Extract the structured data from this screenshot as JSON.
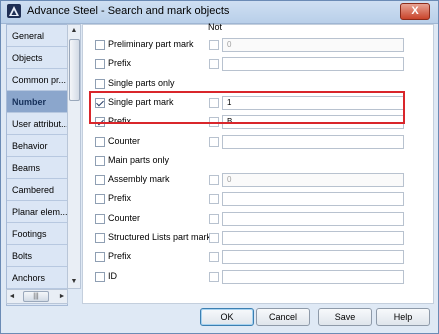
{
  "window": {
    "title": "Advance Steel - Search and mark objects",
    "close_label": "X"
  },
  "sidebar": {
    "items": [
      {
        "label": "General",
        "active": false
      },
      {
        "label": "Objects",
        "active": false
      },
      {
        "label": "Common pr...",
        "active": false
      },
      {
        "label": "Number",
        "active": true
      },
      {
        "label": "User attribut...",
        "active": false
      },
      {
        "label": "Behavior",
        "active": false
      },
      {
        "label": "Beams",
        "active": false
      },
      {
        "label": "Cambered",
        "active": false
      },
      {
        "label": "Planar elem...",
        "active": false
      },
      {
        "label": "Footings",
        "active": false
      },
      {
        "label": "Bolts",
        "active": false
      },
      {
        "label": "Anchors",
        "active": false
      }
    ],
    "scroll_up": "▲",
    "scroll_down": "▼",
    "scroll_left": "◄",
    "scroll_right": "►",
    "grip": "|||"
  },
  "main": {
    "not_header": "Not",
    "rows": [
      {
        "label": "Preliminary part mark",
        "checked": false,
        "has_not": true,
        "has_field": true,
        "value": "0",
        "disabled": true
      },
      {
        "label": "Prefix",
        "checked": false,
        "has_not": true,
        "has_field": true,
        "value": "",
        "disabled": false
      },
      {
        "label": "Single parts only",
        "checked": false,
        "has_not": false,
        "has_field": false,
        "value": "",
        "disabled": false
      },
      {
        "label": "Single part mark",
        "checked": true,
        "has_not": true,
        "has_field": true,
        "value": "1",
        "disabled": false
      },
      {
        "label": "Prefix",
        "checked": true,
        "has_not": true,
        "has_field": true,
        "value": "B",
        "disabled": false
      },
      {
        "label": "Counter",
        "checked": false,
        "has_not": true,
        "has_field": true,
        "value": "",
        "disabled": false
      },
      {
        "label": "Main parts only",
        "checked": false,
        "has_not": false,
        "has_field": false,
        "value": "",
        "disabled": false
      },
      {
        "label": "Assembly mark",
        "checked": false,
        "has_not": true,
        "has_field": true,
        "value": "0",
        "disabled": true
      },
      {
        "label": "Prefix",
        "checked": false,
        "has_not": true,
        "has_field": true,
        "value": "",
        "disabled": false
      },
      {
        "label": "Counter",
        "checked": false,
        "has_not": true,
        "has_field": true,
        "value": "",
        "disabled": false
      },
      {
        "label": "Structured Lists part mark",
        "checked": false,
        "has_not": true,
        "has_field": true,
        "value": "",
        "disabled": false
      },
      {
        "label": "Prefix",
        "checked": false,
        "has_not": true,
        "has_field": true,
        "value": "",
        "disabled": false
      },
      {
        "label": "ID",
        "checked": false,
        "has_not": true,
        "has_field": true,
        "value": "",
        "disabled": false
      }
    ]
  },
  "footer": {
    "ok": "OK",
    "cancel": "Cancel",
    "save": "Save",
    "help": "Help"
  },
  "colors": {
    "highlight": "#d9262b",
    "active_tab": "#8ba6cc"
  }
}
